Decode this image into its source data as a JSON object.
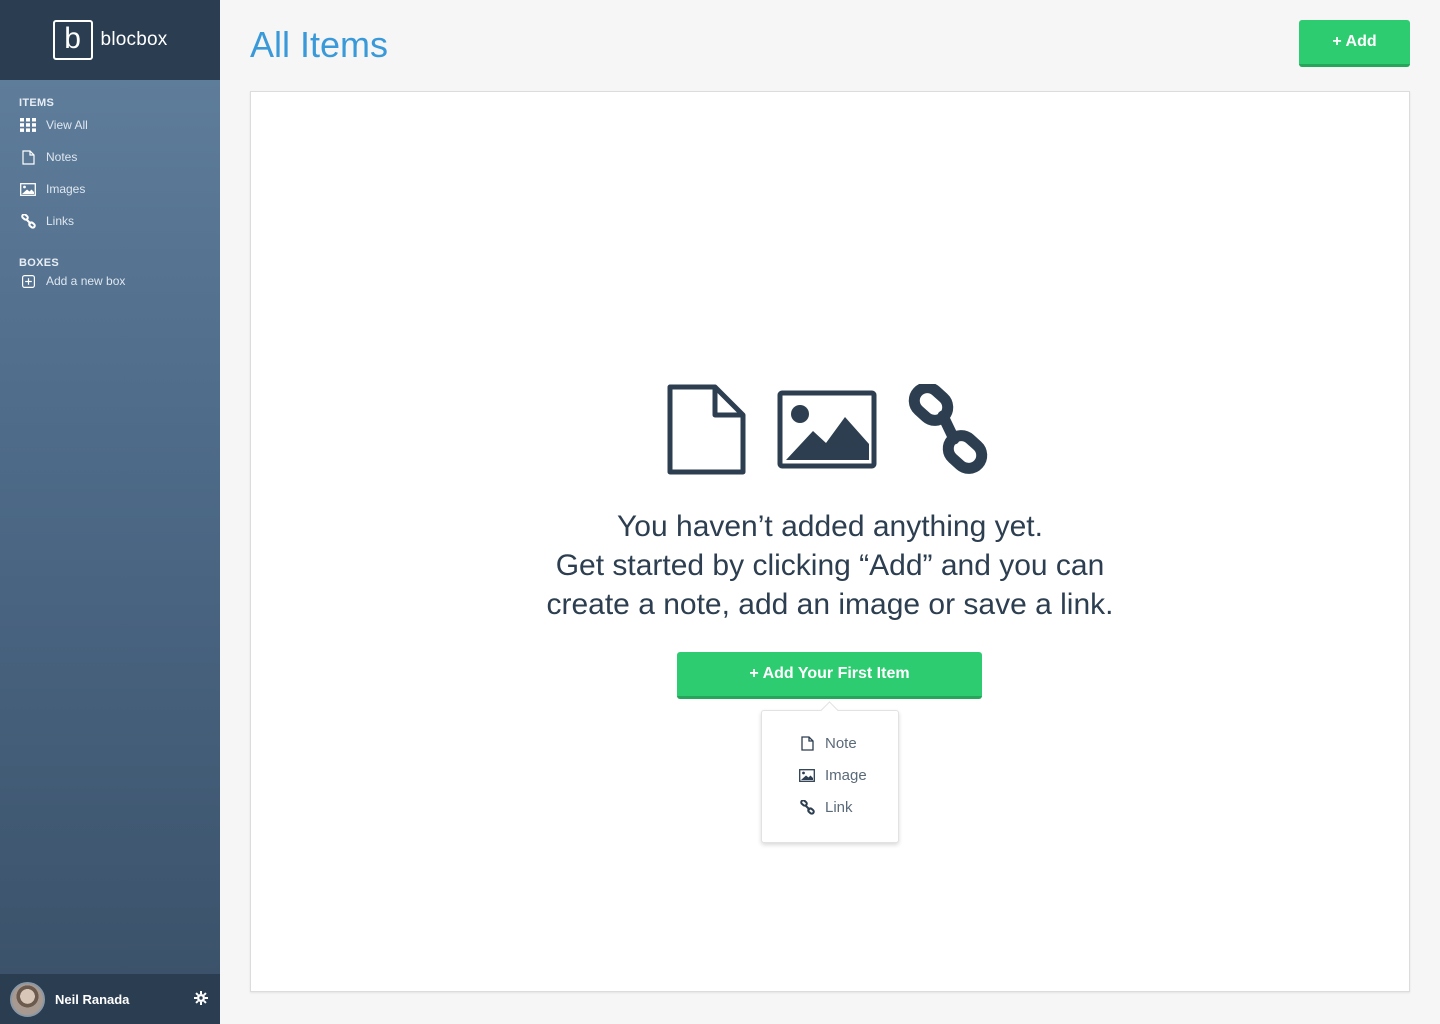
{
  "brand": {
    "mark": "b",
    "name": "blocbox"
  },
  "sidebar": {
    "items_heading": "ITEMS",
    "items": [
      {
        "label": "View All",
        "icon": "grid-icon"
      },
      {
        "label": "Notes",
        "icon": "document-icon"
      },
      {
        "label": "Images",
        "icon": "image-icon"
      },
      {
        "label": "Links",
        "icon": "link-icon"
      }
    ],
    "boxes_heading": "BOXES",
    "boxes": [
      {
        "label": "Add a new box",
        "icon": "plus-square-icon"
      }
    ]
  },
  "user": {
    "name": "Neil Ranada"
  },
  "header": {
    "title": "All Items",
    "add_label": "+ Add"
  },
  "empty_state": {
    "lines": [
      "You haven’t added anything yet.",
      "Get started by clicking “Add” and you can",
      "create a note, add an image or save a link."
    ],
    "button_label": "+ Add Your First Item"
  },
  "dropdown": {
    "items": [
      {
        "label": "Note",
        "icon": "document-icon"
      },
      {
        "label": "Image",
        "icon": "image-icon"
      },
      {
        "label": "Link",
        "icon": "link-icon"
      }
    ]
  },
  "colors": {
    "accent": "#3a9ad9",
    "button": "#2ecc71",
    "sidebar_dark": "#2b3d51",
    "text_dark": "#2c3e50"
  }
}
